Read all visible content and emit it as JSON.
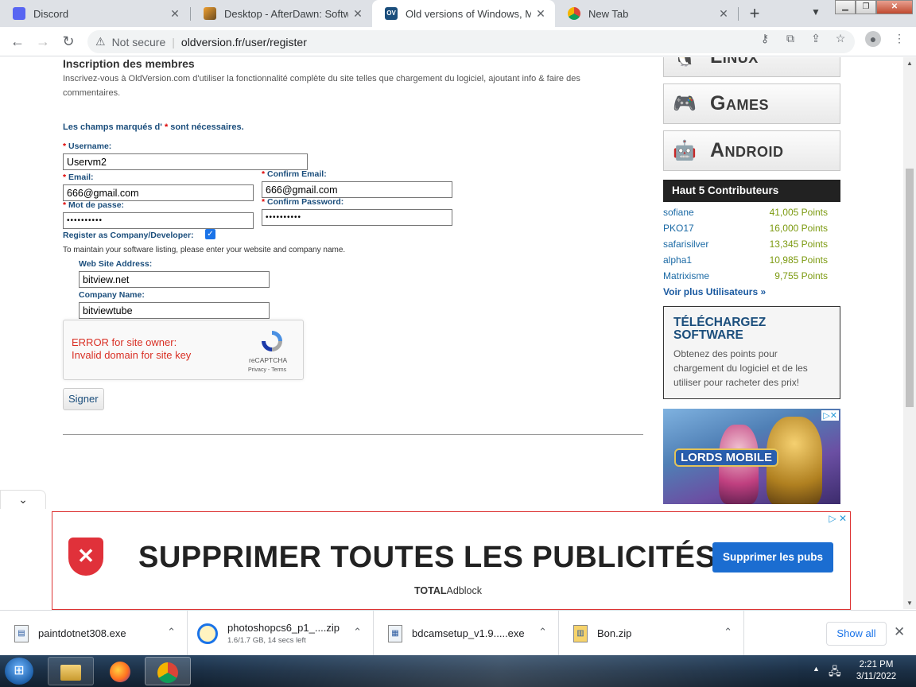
{
  "browser": {
    "tabs": [
      {
        "title": "Discord",
        "icon": "discord-icon",
        "active": false
      },
      {
        "title": "Desktop - AfterDawn: Software",
        "icon": "afterdawn-icon",
        "active": false
      },
      {
        "title": "Old versions of Windows, Mac",
        "icon": "oldversion-icon",
        "active": true
      },
      {
        "title": "New Tab",
        "icon": "chrome-icon",
        "active": false
      }
    ],
    "close_glyph": "✕",
    "new_tab_glyph": "+",
    "security_label": "Not secure",
    "url": "oldversion.fr/user/register"
  },
  "form": {
    "heading": "Inscription des membres",
    "intro": "Inscrivez-vous à OldVersion.com d'utiliser la fonctionnalité complète du site telles que chargement du logiciel, ajoutant info & faire des commentaires.",
    "required_note_prefix": "Les champs marqués d' ",
    "required_star": "*",
    "required_note_suffix": " sont nécessaires.",
    "username_label": "Username:",
    "username_value": "Uservm2",
    "email_label": "Email:",
    "email_value": "666@gmail.com",
    "confirm_email_label": "Confirm Email:",
    "confirm_email_value": "666@gmail.com",
    "password_label": "Mot de passe:",
    "password_value": "••••••••••",
    "confirm_password_label": "Confirm Password:",
    "confirm_password_value": "••••••••••",
    "company_label": "Register as Company/Developer:",
    "company_checked": true,
    "company_note": "To maintain your software listing, please enter your website and company name.",
    "website_label": "Web Site Address:",
    "website_value": "bitview.net",
    "company_name_label": "Company Name:",
    "company_name_value": "bitviewtube",
    "recaptcha": {
      "error_line1": "ERROR for site owner:",
      "error_line2": "Invalid domain for site key",
      "brand": "reCAPTCHA",
      "privacy": "Privacy",
      "terms": "Terms"
    },
    "submit_label": "Signer"
  },
  "sidebar": {
    "os_buttons": [
      {
        "name": "Linux",
        "icon": "linux-icon"
      },
      {
        "name": "Games",
        "icon": "gamepad-icon"
      },
      {
        "name": "Android",
        "icon": "android-icon"
      }
    ],
    "contributors_title": "Haut 5 Contributeurs",
    "contributors": [
      {
        "name": "sofiane",
        "points": "41,005 Points"
      },
      {
        "name": "PKO17",
        "points": "16,000 Points"
      },
      {
        "name": "safarisilver",
        "points": "13,345 Points"
      },
      {
        "name": "alpha1",
        "points": "10,985 Points"
      },
      {
        "name": "Matrixisme",
        "points": "9,755 Points"
      }
    ],
    "more_users": "Voir plus Utilisateurs »",
    "download_title": "TÉLÉCHARGEZ SOFTWARE",
    "download_desc": "Obtenez des points pour chargement du logiciel et de les utiliser pour racheter des prix!",
    "ad_game_title": "LORDS MOBILE"
  },
  "bottom_ad": {
    "headline": "SUPPRIMER TOUTES LES PUBLICITÉS",
    "brand_bold": "TOTAL",
    "brand_rest": "Adblock",
    "cta": "Supprimer les pubs"
  },
  "downloads": {
    "items": [
      {
        "name": "paintdotnet308.exe",
        "sub": ""
      },
      {
        "name": "photoshopcs6_p1_....zip",
        "sub": "1.6/1.7 GB, 14 secs left"
      },
      {
        "name": "bdcamsetup_v1.9.....exe",
        "sub": ""
      },
      {
        "name": "Bon.zip",
        "sub": ""
      }
    ],
    "show_all": "Show all"
  },
  "taskbar": {
    "time": "2:21 PM",
    "date": "3/11/2022"
  },
  "colors": {
    "link_blue": "#1b4e7c",
    "points_green": "#7c9a10",
    "required_red": "#dd0000",
    "ad_button_blue": "#1b6dd1"
  }
}
